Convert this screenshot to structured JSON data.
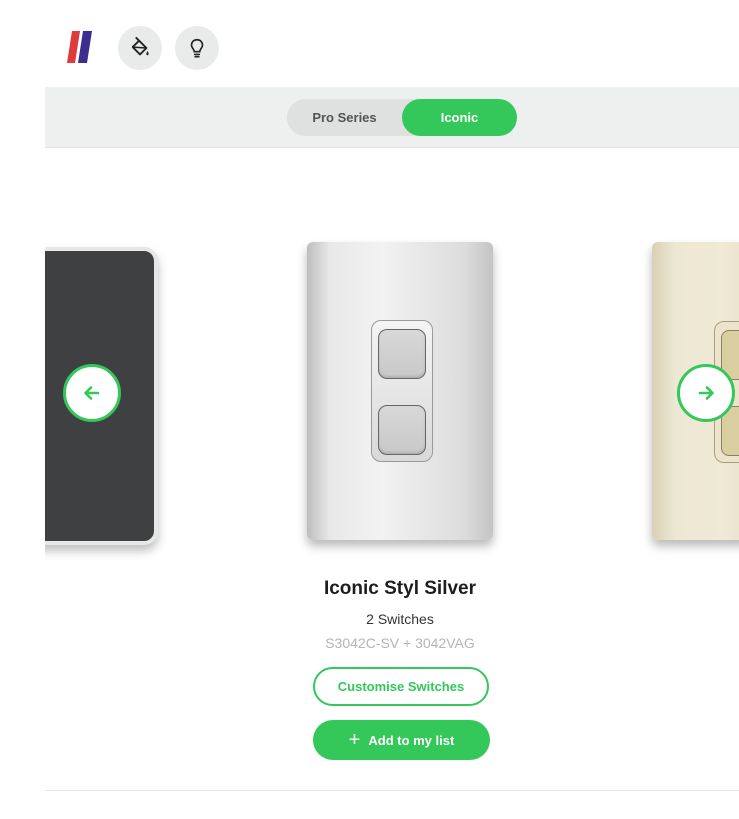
{
  "header": {
    "logo_icon": "brand-logo-icon",
    "paint_icon": "paint-bucket-icon",
    "bulb_icon": "lightbulb-icon"
  },
  "series_toggle": {
    "options": [
      "Pro Series",
      "Iconic"
    ],
    "selected": "Iconic"
  },
  "product": {
    "title": "Iconic Styl Silver",
    "switches": "2 Switches",
    "code": "S3042C-SV + 3042VAG"
  },
  "actions": {
    "customise_label": "Customise Switches",
    "add_label": "Add to my list"
  },
  "carousel": {
    "prev_icon": "arrow-left-icon",
    "next_icon": "arrow-right-icon"
  },
  "colors": {
    "accent": "#34c759",
    "toggle_bg": "#dfe0e0",
    "bar_bg": "#eeefef"
  }
}
